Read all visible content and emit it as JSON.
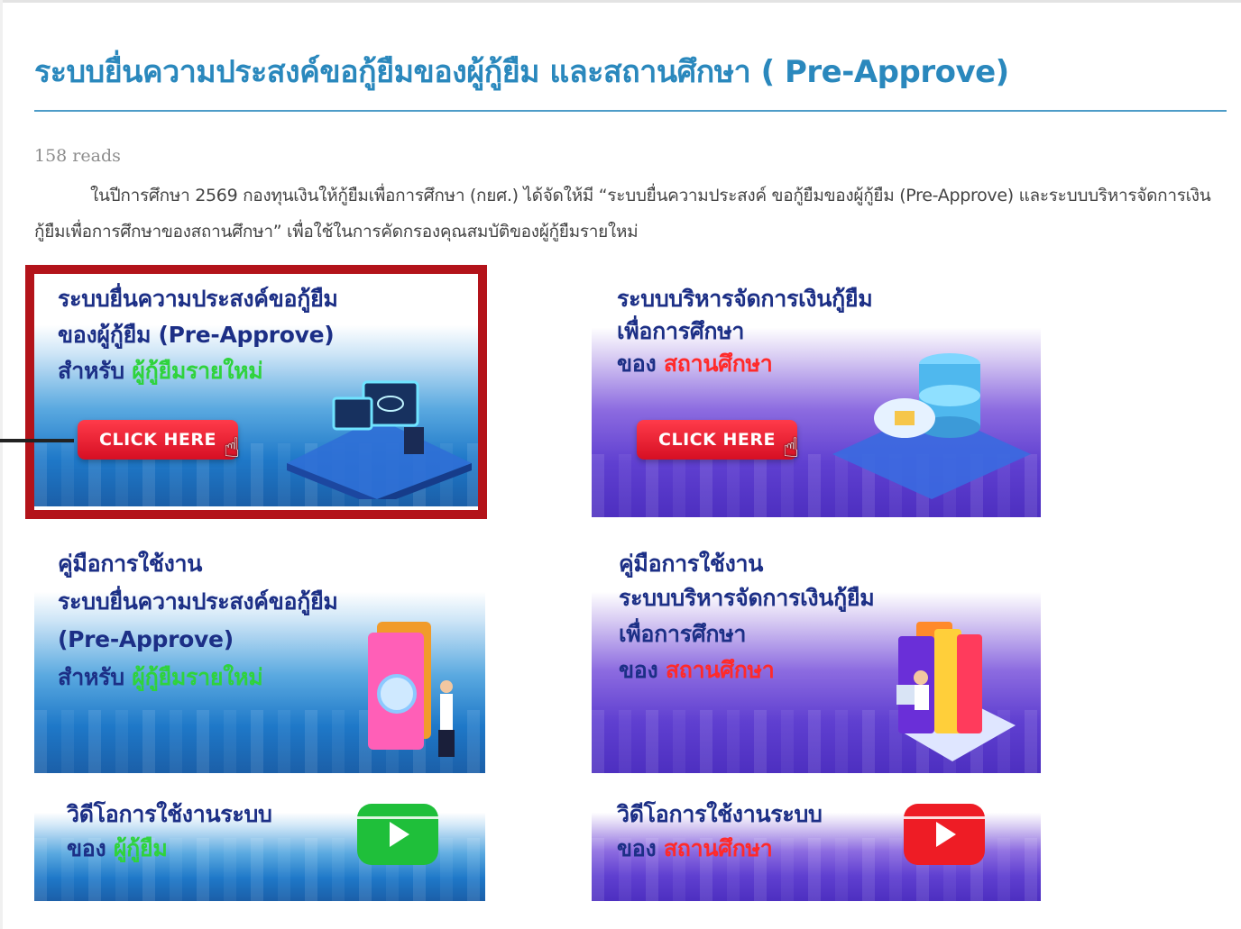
{
  "page": {
    "title": "ระบบยื่นความประสงค์ขอกู้ยืมของผู้กู้ยืม และสถานศึกษา ( Pre-Approve)",
    "reads": "158 reads",
    "intro": "ในปีการศึกษา 2569 กองทุนเงินให้กู้ยืมเพื่อการศึกษา (กยศ.) ได้จัดให้มี “ระบบยื่นความประสงค์ ขอกู้ยืมของผู้กู้ยืม (Pre-Approve) และระบบบริหารจัดการเงินกู้ยืมเพื่อการศึกษาของสถานศึกษา” เพื่อใช้ในการคัดกรองคุณสมบัติของผู้กู้ยืมรายใหม่"
  },
  "banners": {
    "borrower_system": {
      "line1": "ระบบยื่นความประสงค์ขอกู้ยืม",
      "line2": "ของผู้กู้ยืม (Pre-Approve)",
      "line3_prefix": "สำหรับ",
      "line3_highlight": "ผู้กู้ยืมรายใหม่",
      "button": "CLICK HERE"
    },
    "school_system": {
      "line1": "ระบบบริหารจัดการเงินกู้ยืม",
      "line2": "เพื่อการศึกษา",
      "line3_prefix": "ของ",
      "line3_highlight": "สถานศึกษา",
      "button": "CLICK HERE"
    },
    "borrower_manual": {
      "line1": "คู่มือการใช้งาน",
      "line2": "ระบบยื่นความประสงค์ขอกู้ยืม",
      "line3": "(Pre-Approve)",
      "line4_prefix": "สำหรับ",
      "line4_highlight": "ผู้กู้ยืมรายใหม่"
    },
    "school_manual": {
      "line1": "คู่มือการใช้งาน",
      "line2": "ระบบบริหารจัดการเงินกู้ยืม",
      "line3": "เพื่อการศึกษา",
      "line4_prefix": "ของ",
      "line4_highlight": "สถานศึกษา"
    },
    "borrower_video": {
      "line1": "วิดีโอการใช้งานระบบ",
      "line2_prefix": "ของ",
      "line2_highlight": "ผู้กู้ยืม"
    },
    "school_video": {
      "line1": "วิดีโอการใช้งานระบบ",
      "line2_prefix": "ของ",
      "line2_highlight": "สถานศึกษา"
    }
  },
  "colors": {
    "title": "#2a88bd",
    "highlight_box": "#b3131a",
    "green_video": "#1fbf3a",
    "red_video": "#ee1c25"
  }
}
